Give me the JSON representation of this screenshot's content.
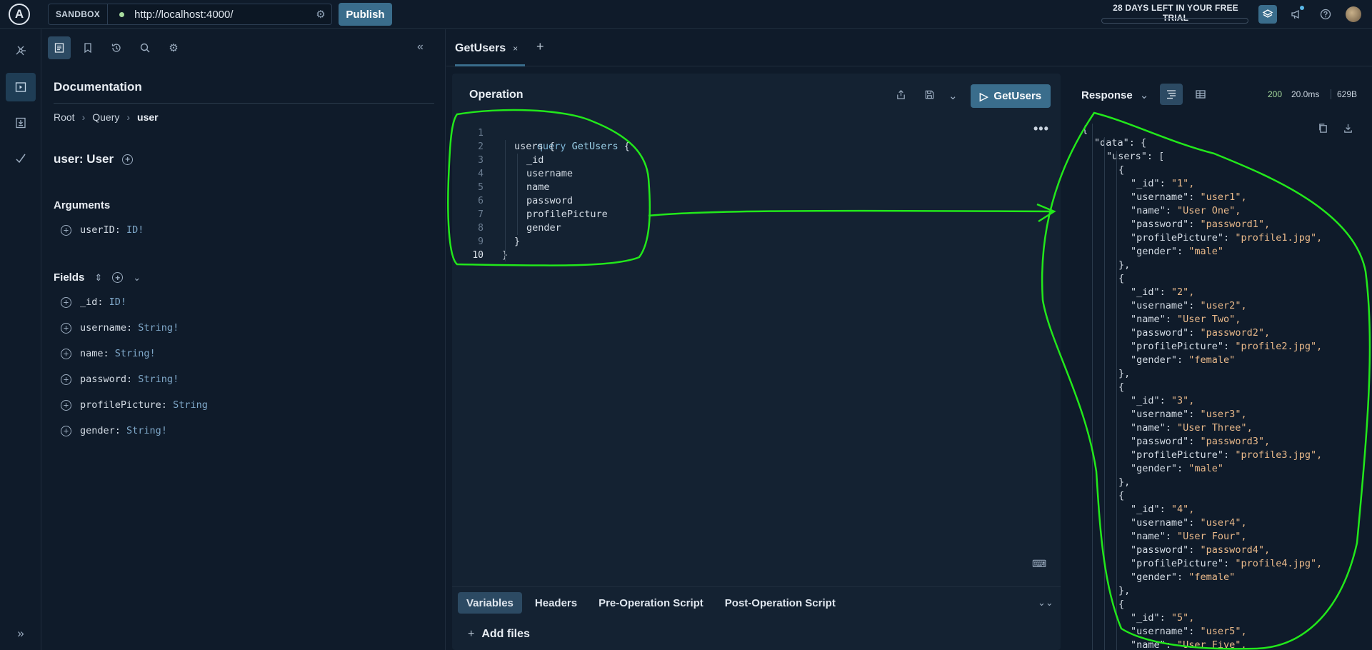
{
  "topbar": {
    "logo": "A",
    "sandbox_label": "SANDBOX",
    "url": "http://localhost:4000/",
    "publish_label": "Publish",
    "trial_text": "28 DAYS LEFT IN YOUR FREE TRIAL",
    "icons": [
      "layers-icon",
      "megaphone-icon",
      "help-icon",
      "avatar"
    ]
  },
  "rail": {
    "items": [
      "graph-icon",
      "explorer-icon",
      "schema-icon",
      "checks-icon",
      "expand-icon"
    ]
  },
  "docs": {
    "title": "Documentation",
    "breadcrumb": [
      "Root",
      "Query",
      "user"
    ],
    "field_title": "user: User",
    "arguments_label": "Arguments",
    "arguments": [
      {
        "name": "userID:",
        "type": "ID!"
      }
    ],
    "fields_label": "Fields",
    "fields": [
      {
        "name": "_id:",
        "type": "ID!"
      },
      {
        "name": "username:",
        "type": "String!"
      },
      {
        "name": "name:",
        "type": "String!"
      },
      {
        "name": "password:",
        "type": "String!"
      },
      {
        "name": "profilePicture:",
        "type": "String"
      },
      {
        "name": "gender:",
        "type": "String!"
      }
    ]
  },
  "tabs": {
    "active": "GetUsers",
    "close": "×",
    "add": "+"
  },
  "operation": {
    "title": "Operation",
    "run_label": "GetUsers",
    "code": {
      "line1_kw": "query",
      "line1_name": "GetUsers",
      "line1_brace": "{",
      "line2": "users {",
      "line3": "_id",
      "line4": "username",
      "line5": "name",
      "line6": "password",
      "line7": "profilePicture",
      "line8": "gender",
      "line9": "}",
      "line10": "}"
    },
    "line_numbers": [
      "1",
      "2",
      "3",
      "4",
      "5",
      "6",
      "7",
      "8",
      "9",
      "10"
    ],
    "more": "•••",
    "var_tabs": [
      "Variables",
      "Headers",
      "Pre-Operation Script",
      "Post-Operation Script"
    ],
    "add_files": "Add files"
  },
  "response": {
    "title": "Response",
    "status": "200",
    "time": "20.0ms",
    "size": "629B",
    "status_color": "#a8dc9e",
    "lines": [
      {
        "k": "{",
        "v": ""
      },
      {
        "k": "\"data\": {",
        "v": ""
      },
      {
        "k": "\"users\": [",
        "v": ""
      },
      {
        "k": "{",
        "v": ""
      },
      {
        "k": "\"_id\": ",
        "v": "\"1\","
      },
      {
        "k": "\"username\": ",
        "v": "\"user1\","
      },
      {
        "k": "\"name\": ",
        "v": "\"User One\","
      },
      {
        "k": "\"password\": ",
        "v": "\"password1\","
      },
      {
        "k": "\"profilePicture\": ",
        "v": "\"profile1.jpg\","
      },
      {
        "k": "\"gender\": ",
        "v": "\"male\""
      },
      {
        "k": "},",
        "v": ""
      },
      {
        "k": "{",
        "v": ""
      },
      {
        "k": "\"_id\": ",
        "v": "\"2\","
      },
      {
        "k": "\"username\": ",
        "v": "\"user2\","
      },
      {
        "k": "\"name\": ",
        "v": "\"User Two\","
      },
      {
        "k": "\"password\": ",
        "v": "\"password2\","
      },
      {
        "k": "\"profilePicture\": ",
        "v": "\"profile2.jpg\","
      },
      {
        "k": "\"gender\": ",
        "v": "\"female\""
      },
      {
        "k": "},",
        "v": ""
      },
      {
        "k": "{",
        "v": ""
      },
      {
        "k": "\"_id\": ",
        "v": "\"3\","
      },
      {
        "k": "\"username\": ",
        "v": "\"user3\","
      },
      {
        "k": "\"name\": ",
        "v": "\"User Three\","
      },
      {
        "k": "\"password\": ",
        "v": "\"password3\","
      },
      {
        "k": "\"profilePicture\": ",
        "v": "\"profile3.jpg\","
      },
      {
        "k": "\"gender\": ",
        "v": "\"male\""
      },
      {
        "k": "},",
        "v": ""
      },
      {
        "k": "{",
        "v": ""
      },
      {
        "k": "\"_id\": ",
        "v": "\"4\","
      },
      {
        "k": "\"username\": ",
        "v": "\"user4\","
      },
      {
        "k": "\"name\": ",
        "v": "\"User Four\","
      },
      {
        "k": "\"password\": ",
        "v": "\"password4\","
      },
      {
        "k": "\"profilePicture\": ",
        "v": "\"profile4.jpg\","
      },
      {
        "k": "\"gender\": ",
        "v": "\"female\""
      },
      {
        "k": "},",
        "v": ""
      },
      {
        "k": "{",
        "v": ""
      },
      {
        "k": "\"_id\": ",
        "v": "\"5\","
      },
      {
        "k": "\"username\": ",
        "v": "\"user5\","
      },
      {
        "k": "\"name\": ",
        "v": "\"User Five\","
      }
    ]
  },
  "colors": {
    "accent": "#3a6d8c",
    "annotation": "#22e81b",
    "string_value": "#e9b98a"
  }
}
